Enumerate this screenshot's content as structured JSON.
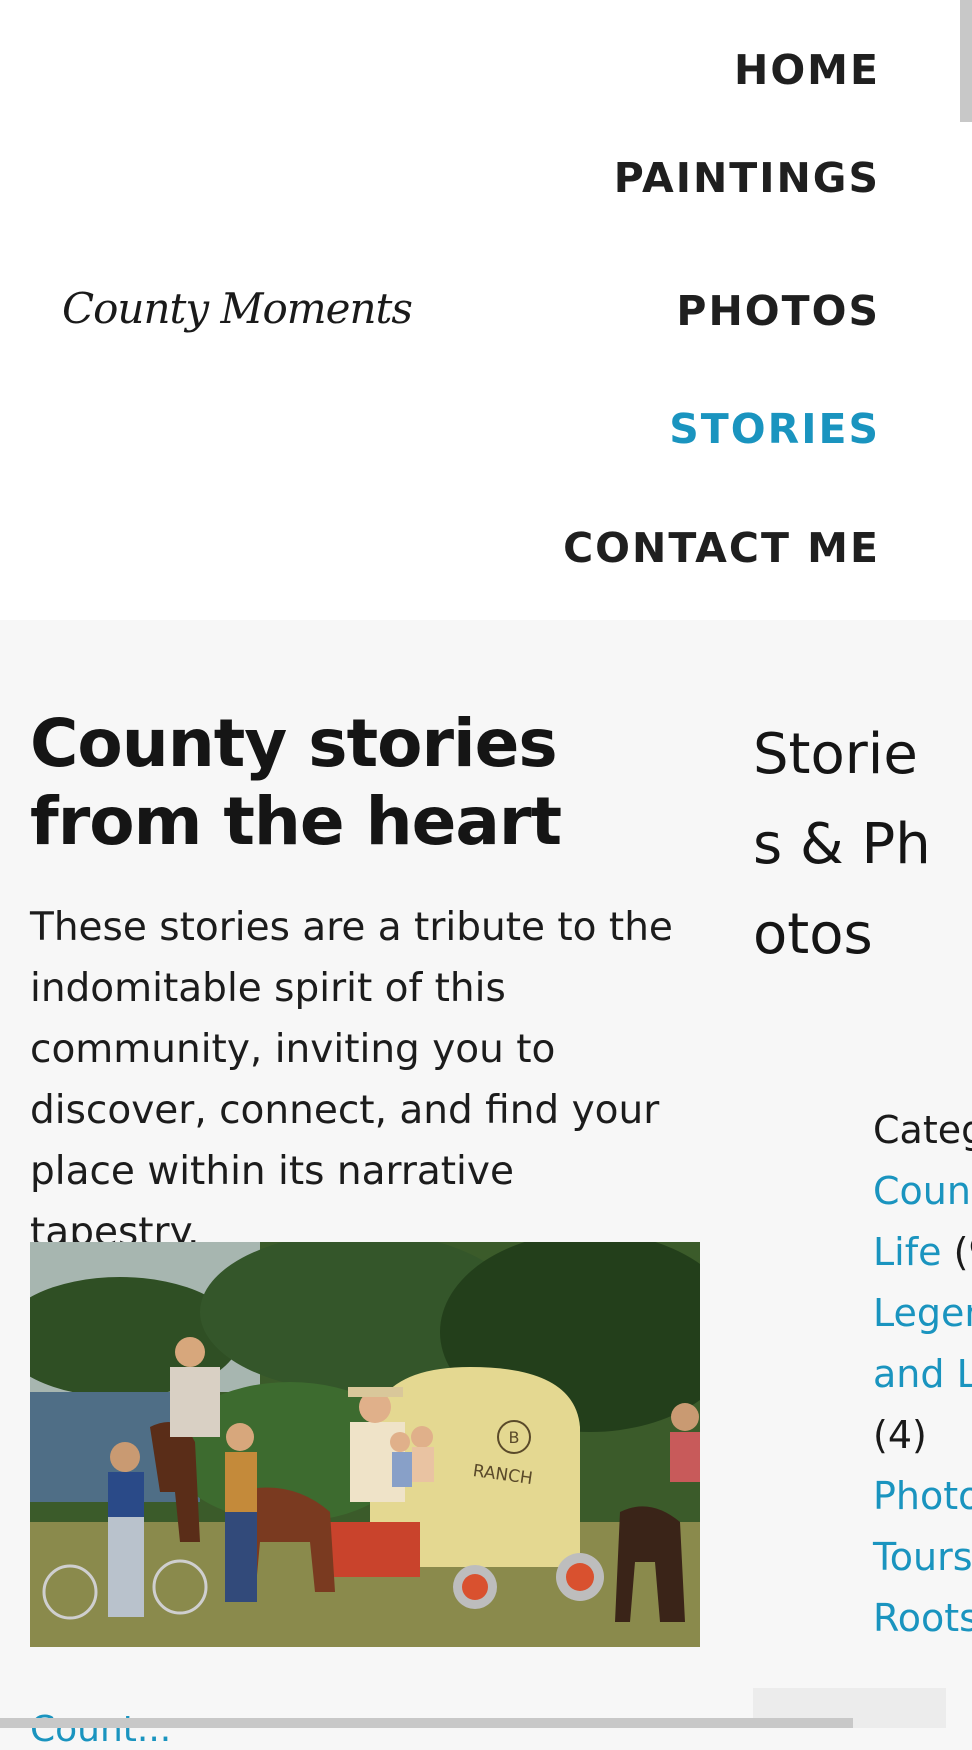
{
  "site": {
    "logo": "County Moments"
  },
  "nav": {
    "items": [
      {
        "label": "HOME",
        "active": false
      },
      {
        "label": "PAINTINGS",
        "active": false
      },
      {
        "label": "PHOTOS",
        "active": false
      },
      {
        "label": "STORIES",
        "active": true
      },
      {
        "label": "CONTACT ME",
        "active": false
      }
    ]
  },
  "main": {
    "title": "County stories from the heart",
    "intro": "These stories are a tribute to the indomitable spirit of this community, inviting you to discover, connect, and find your place within its narrative tapestry.",
    "image_text": {
      "wagon_sign_letter": "B",
      "wagon_sign_word": "RANCH"
    },
    "next_post_link": "Count..."
  },
  "sidebar": {
    "heading": "Stories & Photos",
    "categories_label": "Categ",
    "categories": [
      {
        "label_lines": [
          "Count",
          "Life"
        ],
        "count": "(9"
      },
      {
        "label_lines": [
          "Legen",
          "and L"
        ],
        "count": "(4)"
      },
      {
        "label_lines": [
          "Photo",
          "Tours",
          "Roots"
        ],
        "count": ""
      }
    ]
  },
  "colors": {
    "accent": "#1a94bf",
    "text": "#1a1a1a",
    "background": "#f7f7f7",
    "header_bg": "#ffffff"
  }
}
